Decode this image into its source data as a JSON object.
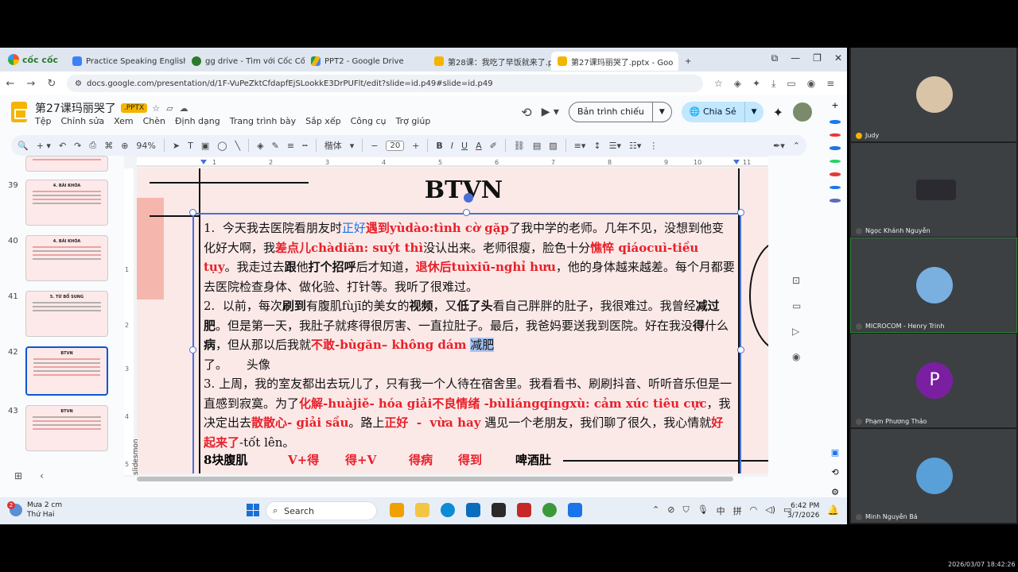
{
  "browser": {
    "brand": "cốc cốc",
    "tabs": [
      {
        "label": "Practice Speaking English Onlin",
        "color": "#3b82f6",
        "active": false
      },
      {
        "label": "gg drive - Tìm với Cốc Cốc",
        "color": "#2a7a2a",
        "active": false
      },
      {
        "label": "PPT2 - Google Drive",
        "color": "#f4b400",
        "active": false
      },
      {
        "label": "第28课：我吃了早饭就来了.ppt",
        "color": "#f4b400",
        "active": false
      },
      {
        "label": "第27课玛丽哭了.pptx - Goo",
        "color": "#f4b400",
        "active": true
      }
    ],
    "new_tab": "+",
    "url": "docs.google.com/presentation/d/1F-VuPeZktCfdapfEjSLookkE3DrPUFlt/edit?slide=id.p49#slide=id.p49"
  },
  "doc": {
    "title": "第27课玛丽哭了",
    "badge": ".PPTX",
    "menu": [
      "Tệp",
      "Chỉnh sửa",
      "Xem",
      "Chèn",
      "Định dạng",
      "Trang trình bày",
      "Sắp xếp",
      "Công cụ",
      "Trợ giúp"
    ],
    "present_label": "Bản trình chiếu",
    "share_label": "Chia Sẻ"
  },
  "toolbar": {
    "zoom": "94%",
    "font": "楷体",
    "font_size": "20"
  },
  "filmstrip": {
    "slides": [
      {
        "num": "39",
        "title": "4. BÀI KHÓA"
      },
      {
        "num": "40",
        "title": "4. BÀI KHÓA"
      },
      {
        "num": "41",
        "title": "5. TỪ BỔ SUNG"
      },
      {
        "num": "42",
        "title": "BTVN",
        "active": true
      },
      {
        "num": "43",
        "title": "BTVN"
      }
    ]
  },
  "ruler": [
    "1",
    "2",
    "3",
    "4",
    "5",
    "6",
    "7",
    "8",
    "9",
    "10",
    "11"
  ],
  "ruler_v": [
    "1",
    "2",
    "3",
    "4",
    "5"
  ],
  "slide": {
    "title": "BTVN",
    "watermark": "slidesmon",
    "bottom_row": [
      "8块腹肌",
      "V+得",
      "得+V",
      "得病",
      "得到",
      "啤酒肚"
    ]
  },
  "taskbar": {
    "weather": "Mưa 2 cm",
    "weather_sub": "Thứ Hai",
    "weather_badge": "2",
    "search": "Search",
    "tray": [
      "中",
      "拼"
    ],
    "time": "6:42 PM",
    "date": "3/7/2026"
  },
  "participants": [
    {
      "name": "Judy",
      "photo": "#d9c4a8"
    },
    {
      "name": "Ngọc Khánh Nguyễn",
      "photo": "#2a2a30"
    },
    {
      "name": "MICROCOM - Henry Trinh",
      "photo": "#7ab0e0"
    },
    {
      "name": "Phạm Phương Thảo",
      "photo": "#7b1fa2",
      "initial": "P"
    },
    {
      "name": "Minh Nguyễn Bá",
      "photo": "#5aa0d8"
    }
  ],
  "recording_timestamp": "2026/03/07 18:42:26"
}
